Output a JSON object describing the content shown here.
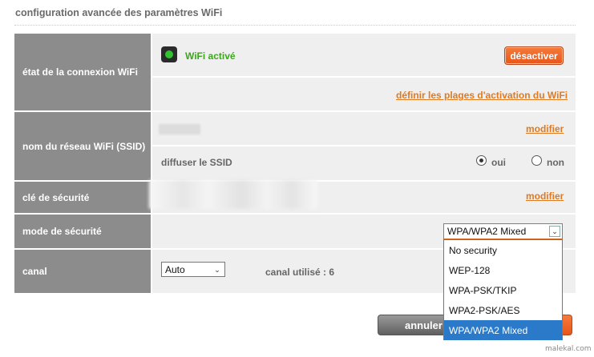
{
  "page": {
    "title": "configuration avancée des paramètres WiFi",
    "watermark": "malekal.com"
  },
  "rows": {
    "connection": {
      "label": "état de la connexion WiFi",
      "status_icon": "green-led-icon",
      "status_text": "WiFi activé",
      "status_color": "#3da51e",
      "toggle_label": "désactiver",
      "schedule_link": "définir les plages d'activation du WiFi"
    },
    "ssid": {
      "label": "nom du réseau WiFi (SSID)",
      "modify_link": "modifier",
      "broadcast_label": "diffuser le SSID",
      "broadcast_options": [
        "oui",
        "non"
      ],
      "broadcast_selected": "oui"
    },
    "key": {
      "label": "clé de sécurité",
      "modify_link": "modifier"
    },
    "security": {
      "label": "mode de sécurité",
      "selected": "WPA/WPA2 Mixed",
      "options": [
        "No security",
        "WEP-128",
        "WPA-PSK/TKIP",
        "WPA2-PSK/AES",
        "WPA/WPA2 Mixed"
      ]
    },
    "channel": {
      "label": "canal",
      "selected": "Auto",
      "used_text": "canal utilisé : 6"
    }
  },
  "actions": {
    "cancel_label": "annuler"
  },
  "colors": {
    "label_bg": "#8c8c8c",
    "cell_bg": "#efefef",
    "accent_orange": "#e8561a",
    "link_orange": "#e07a20",
    "selection_blue": "#2b79c9"
  }
}
